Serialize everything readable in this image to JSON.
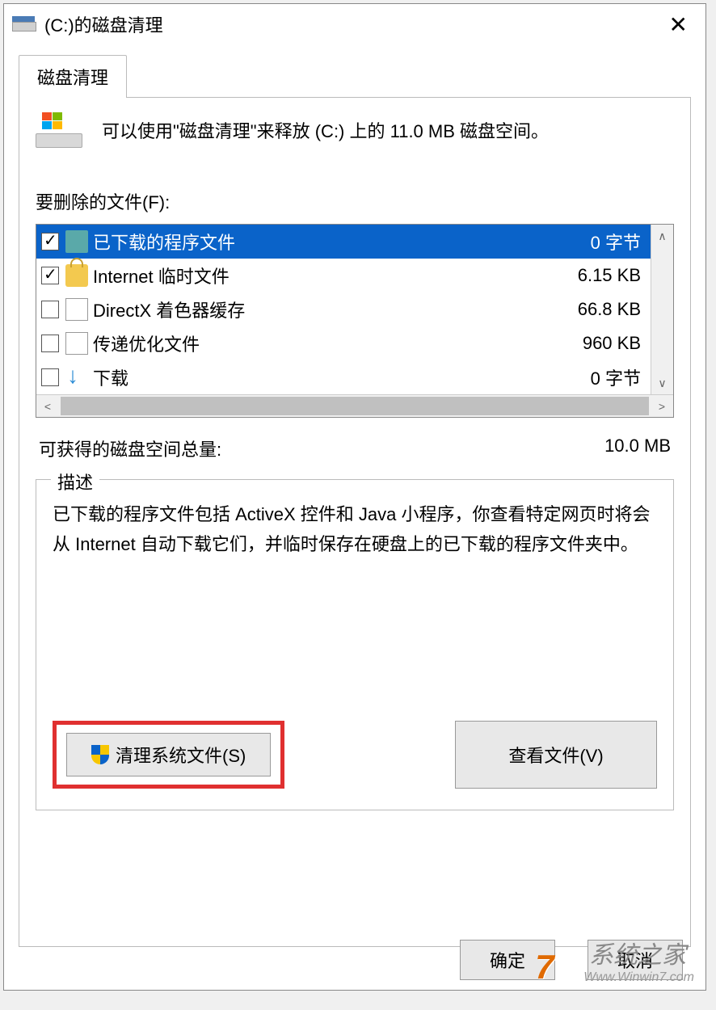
{
  "window": {
    "title": "(C:)的磁盘清理",
    "close_label": "✕"
  },
  "tab": {
    "label": "磁盘清理"
  },
  "summary": "可以使用\"磁盘清理\"来释放  (C:) 上的 11.0 MB 磁盘空间。",
  "files_label": "要删除的文件(F):",
  "file_list": [
    {
      "checked": true,
      "icon": "folder",
      "name": "已下载的程序文件",
      "size": "0 字节",
      "selected": true
    },
    {
      "checked": true,
      "icon": "lock",
      "name": "Internet 临时文件",
      "size": "6.15 KB",
      "selected": false
    },
    {
      "checked": false,
      "icon": "file",
      "name": "DirectX 着色器缓存",
      "size": "66.8 KB",
      "selected": false
    },
    {
      "checked": false,
      "icon": "file",
      "name": "传递优化文件",
      "size": "960 KB",
      "selected": false
    },
    {
      "checked": false,
      "icon": "arrow",
      "name": "下载",
      "size": "0 字节",
      "selected": false
    }
  ],
  "gain": {
    "label": "可获得的磁盘空间总量:",
    "value": "10.0 MB"
  },
  "description": {
    "legend": "描述",
    "text": "已下载的程序文件包括 ActiveX 控件和 Java 小程序，你查看特定网页时将会从 Internet 自动下载它们，并临时保存在硬盘上的已下载的程序文件夹中。"
  },
  "buttons": {
    "clean_system": "清理系统文件(S)",
    "view_files": "查看文件(V)",
    "ok": "确定",
    "cancel": "取消"
  },
  "watermark": {
    "brand": "系统之家",
    "url": "Www.Winwin7.com",
    "logo": "7"
  }
}
